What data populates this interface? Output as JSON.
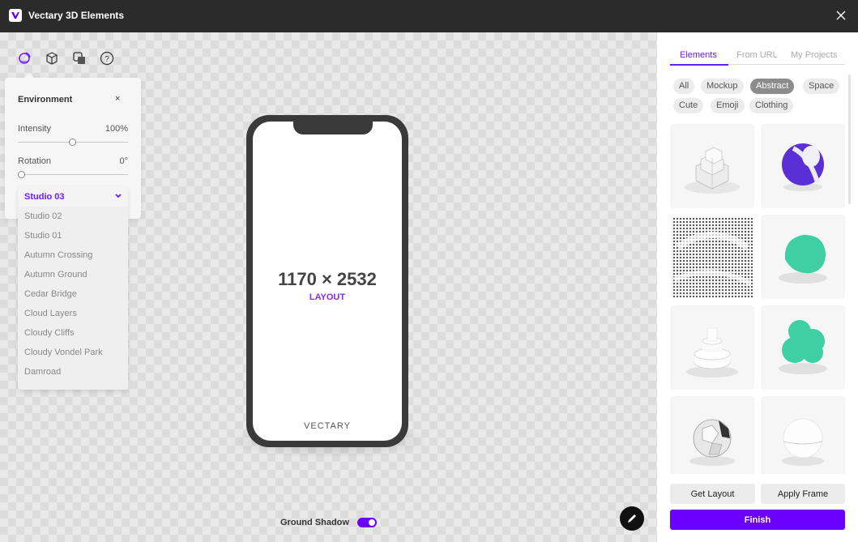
{
  "app": {
    "title": "Vectary 3D Elements"
  },
  "toolbar": {
    "icons": [
      "environment-icon",
      "cube-icon",
      "layers-icon",
      "help-icon"
    ]
  },
  "environment": {
    "title": "Environment",
    "close_label": "×",
    "intensity": {
      "label": "Intensity",
      "value_text": "100%",
      "fraction": 0.5
    },
    "rotation": {
      "label": "Rotation",
      "value_text": "0°",
      "fraction": 0.0
    },
    "preset_selected": "Studio 03",
    "preset_options": [
      "Studio 02",
      "Studio 01",
      "Autumn Crossing",
      "Autumn Ground",
      "Cedar Bridge",
      "Cloud Layers",
      "Cloudy Cliffs",
      "Cloudy Vondel Park",
      "Damroad"
    ]
  },
  "preview": {
    "dimensions": "1170 × 2532",
    "layout_label": "LAYOUT",
    "brand": "VECTARY"
  },
  "ground_shadow": {
    "label": "Ground Shadow",
    "enabled": true
  },
  "sidebar": {
    "tabs": [
      {
        "label": "Elements",
        "active": true
      },
      {
        "label": "From URL",
        "active": false
      },
      {
        "label": "My Projects",
        "active": false
      }
    ],
    "categories": [
      {
        "label": "All",
        "active": false
      },
      {
        "label": "Mockup",
        "active": false
      },
      {
        "label": "Abstract",
        "active": true
      },
      {
        "label": "Space",
        "active": false
      },
      {
        "label": "Cute",
        "active": false
      },
      {
        "label": "Emoji",
        "active": false
      },
      {
        "label": "Clothing",
        "active": false
      }
    ],
    "elements": [
      "white-cubes-stack",
      "purple-striped-ball",
      "pixel-wave-field",
      "teal-blob",
      "white-stacked-rings",
      "teal-cluster-blob",
      "faceted-sphere",
      "white-sphere"
    ],
    "get_layout_label": "Get Layout",
    "apply_frame_label": "Apply Frame",
    "finish_label": "Finish"
  },
  "colors": {
    "accent": "#6b00ff",
    "titlebar": "#2b2b2b",
    "teal": "#3ecfa3"
  }
}
